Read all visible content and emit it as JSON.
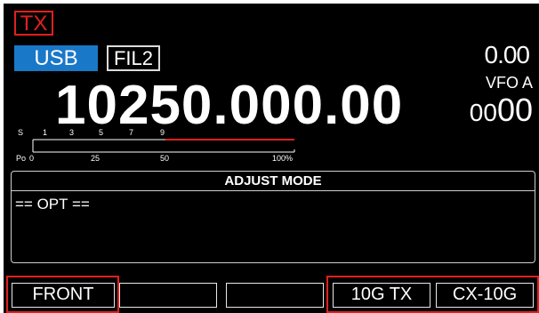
{
  "status": {
    "tx_indicator": "TX",
    "mode": "USB",
    "filter": "FIL2"
  },
  "frequency": {
    "main": "10250.000.00",
    "rit_offset": "0.00",
    "vfo_label": "VFO A",
    "aux_small": "00",
    "aux_large": "00"
  },
  "meter": {
    "s_label": "S",
    "s_ticks": [
      "1",
      "3",
      "5",
      "7",
      "9"
    ],
    "po_label": "Po",
    "po_ticks": [
      "0",
      "25",
      "50",
      "100%"
    ]
  },
  "adjust_panel": {
    "title": "ADJUST MODE",
    "line1": "== OPT =="
  },
  "softkeys": [
    {
      "label": "FRONT"
    },
    {
      "label": ""
    },
    {
      "label": ""
    },
    {
      "label": "10G TX"
    },
    {
      "label": "CX-10G"
    }
  ],
  "colors": {
    "screen_bg": "#000000",
    "mode_badge": "#1a78c8",
    "tx_red": "#e02020",
    "text": "#ffffff"
  }
}
